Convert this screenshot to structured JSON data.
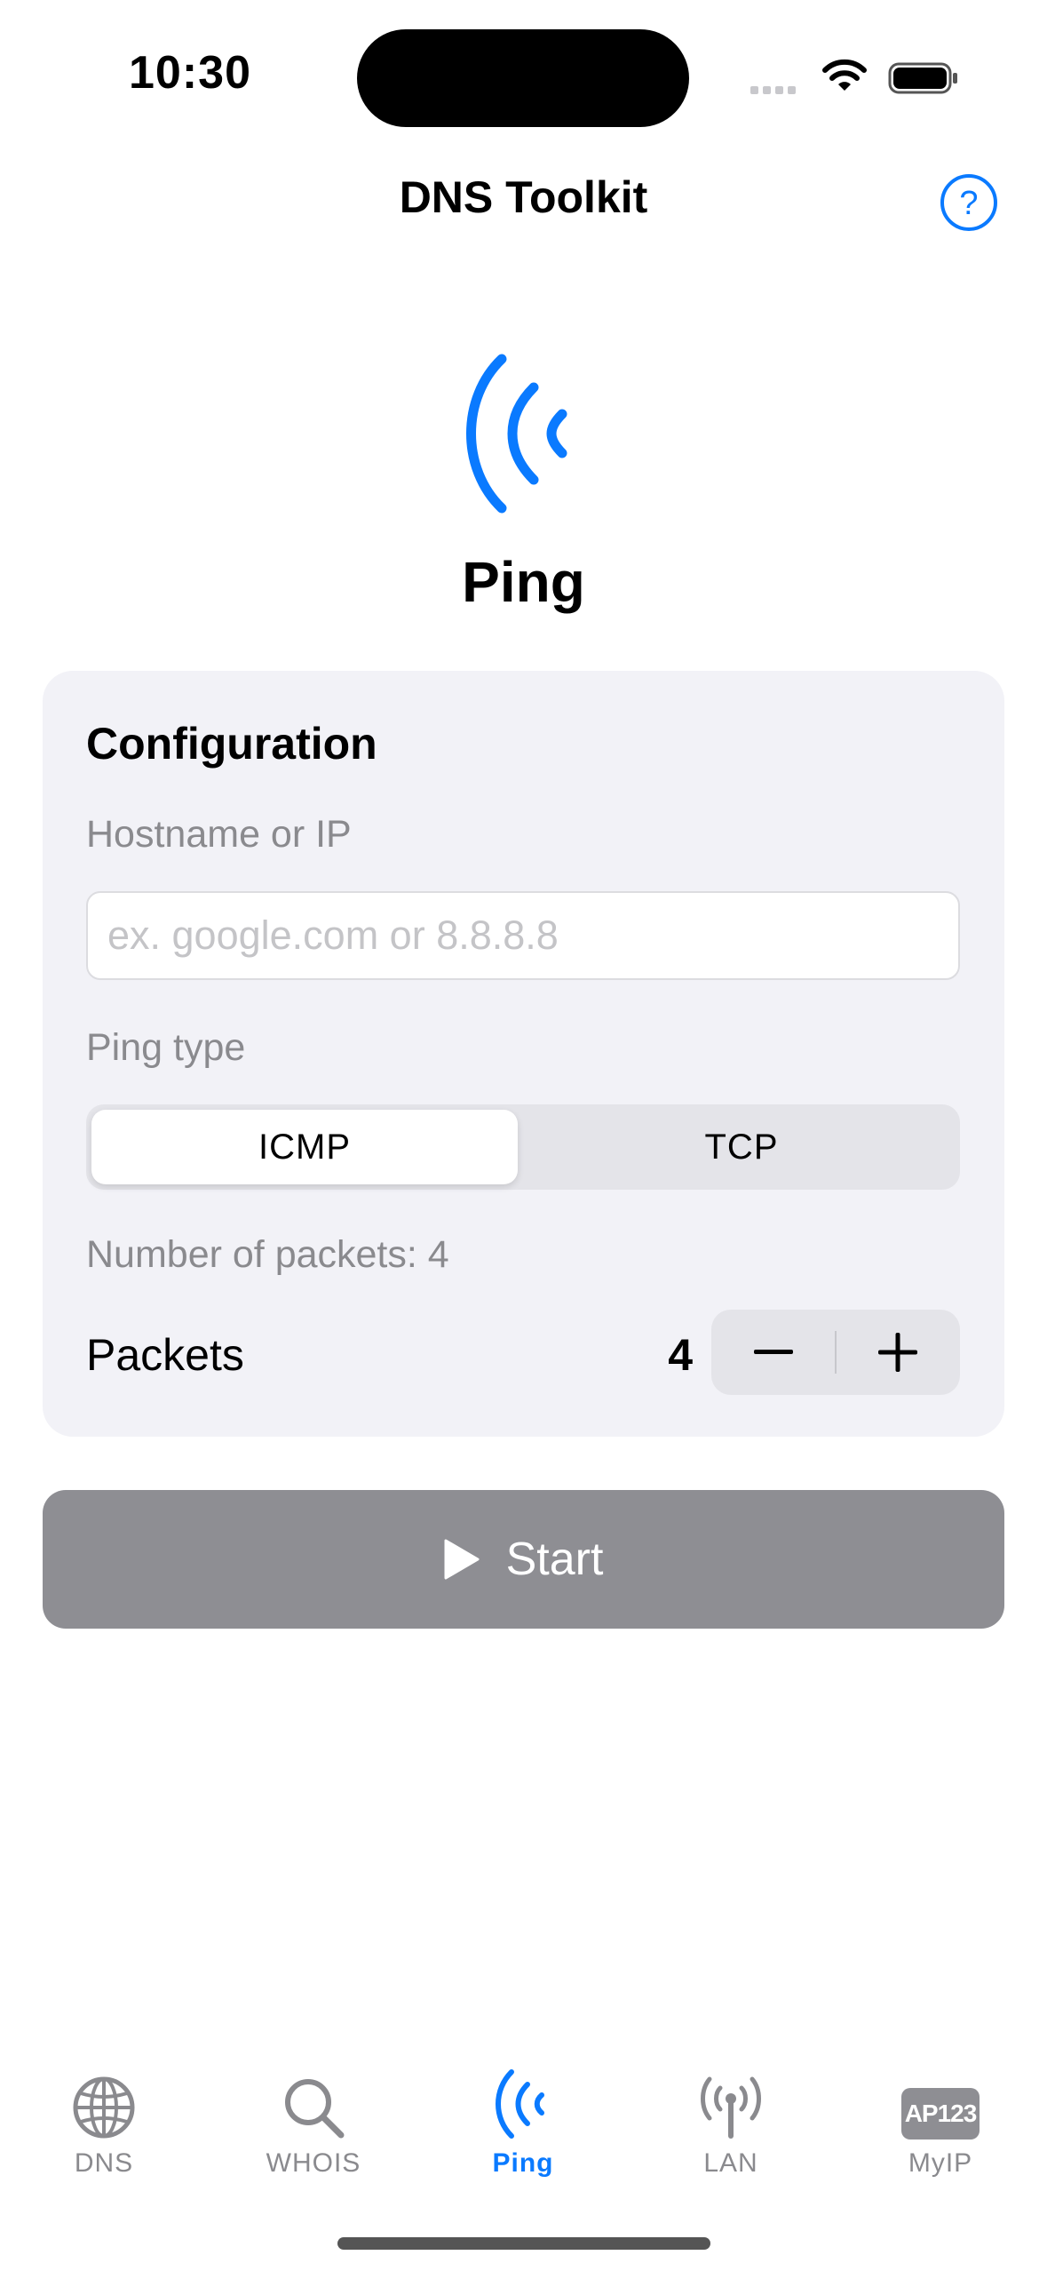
{
  "status_bar": {
    "time": "10:30"
  },
  "nav": {
    "title": "DNS Toolkit",
    "help_icon": "question-circle-icon"
  },
  "hero": {
    "icon": "wave-ping-icon",
    "title": "Ping"
  },
  "config": {
    "heading": "Configuration",
    "host_label": "Hostname or IP",
    "host_value": "",
    "host_placeholder": "ex. google.com or 8.8.8.8",
    "ping_type_label": "Ping type",
    "ping_types": [
      "ICMP",
      "TCP"
    ],
    "ping_type_selected": "ICMP",
    "packets_info": "Number of packets: 4",
    "packets_label": "Packets",
    "packets_value": "4"
  },
  "start_button": {
    "label": "Start",
    "icon": "play-icon"
  },
  "tabs": [
    {
      "label": "DNS",
      "icon": "globe-icon",
      "active": false
    },
    {
      "label": "WHOIS",
      "icon": "magnifier-icon",
      "active": false
    },
    {
      "label": "Ping",
      "icon": "wave-ping-icon",
      "active": true
    },
    {
      "label": "LAN",
      "icon": "antenna-icon",
      "active": false
    },
    {
      "label": "MyIP",
      "icon": "ap123-badge-icon",
      "badge_text": "AP123",
      "active": false
    }
  ],
  "colors": {
    "accent": "#0a7aff",
    "card_bg": "#f2f2f7",
    "disabled_button": "#8e8e93",
    "secondary_text": "#8a8a8e"
  }
}
